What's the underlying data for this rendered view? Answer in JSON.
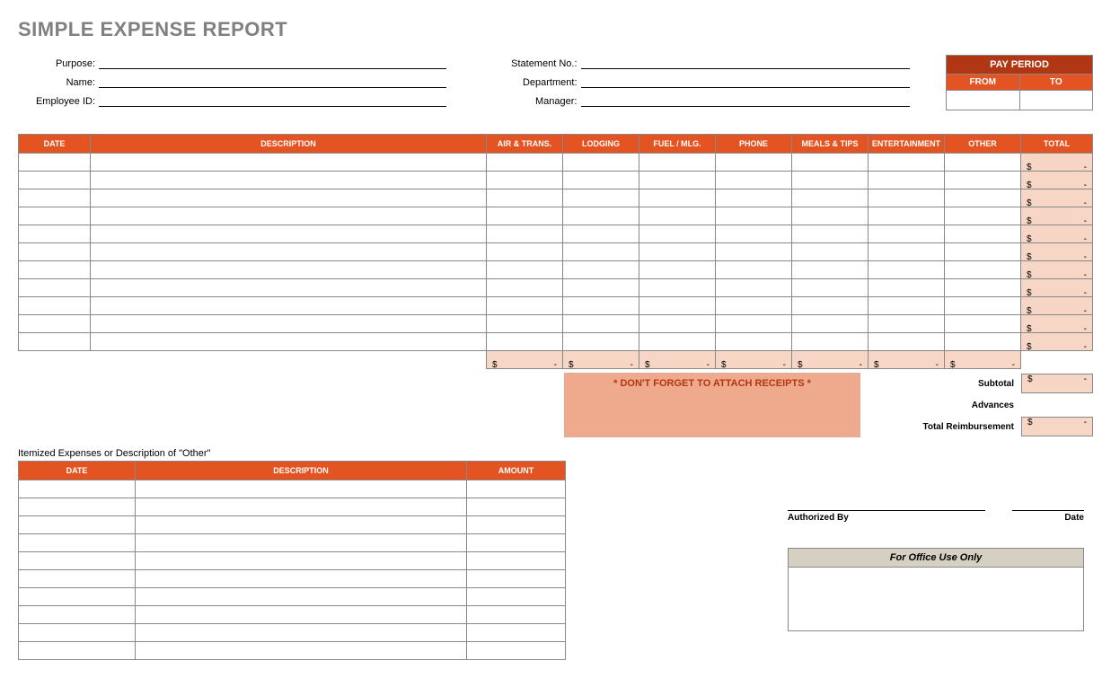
{
  "title": "SIMPLE EXPENSE REPORT",
  "fields_left": [
    {
      "label": "Purpose:"
    },
    {
      "label": "Name:"
    },
    {
      "label": "Employee ID:"
    }
  ],
  "fields_right": [
    {
      "label": "Statement No.:"
    },
    {
      "label": "Department:"
    },
    {
      "label": "Manager:"
    }
  ],
  "pay_period": {
    "title": "PAY PERIOD",
    "from": "FROM",
    "to": "TO"
  },
  "expense_headers": [
    "DATE",
    "DESCRIPTION",
    "AIR & TRANS.",
    "LODGING",
    "FUEL / MLG.",
    "PHONE",
    "MEALS & TIPS",
    "ENTERTAINMENT",
    "OTHER",
    "TOTAL"
  ],
  "expense_rows": 11,
  "currency": "$",
  "empty_val": "-",
  "summary": {
    "subtotal": "Subtotal",
    "advances": "Advances",
    "reimbursement": "Total Reimbursement"
  },
  "reminder": "* DON'T FORGET TO ATTACH RECEIPTS *",
  "itemized_title": "Itemized Expenses or Description of \"Other\"",
  "itemized_headers": [
    "DATE",
    "DESCRIPTION",
    "AMOUNT"
  ],
  "itemized_rows": 10,
  "signature": {
    "authorized": "Authorized By",
    "date": "Date"
  },
  "office_use": "For Office Use Only"
}
